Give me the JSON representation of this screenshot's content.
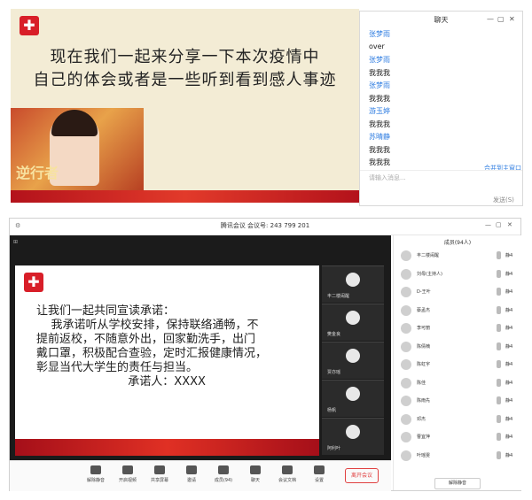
{
  "top_slide": {
    "line1": "现在我们一起来分享一下本次疫情中",
    "line2": "自己的体会或者是一些听到看到感人事迹",
    "poster_text": "逆行者"
  },
  "chat": {
    "title": "聊天",
    "messages": [
      {
        "text": "张梦雨",
        "kind": "name"
      },
      {
        "text": "over",
        "kind": "text"
      },
      {
        "text": "张梦雨",
        "kind": "name"
      },
      {
        "text": "我我我",
        "kind": "text"
      },
      {
        "text": "张梦雨",
        "kind": "name"
      },
      {
        "text": "我我我",
        "kind": "text"
      },
      {
        "text": "游玉婷",
        "kind": "name"
      },
      {
        "text": "我我我",
        "kind": "text"
      },
      {
        "text": "苏晴静",
        "kind": "name"
      },
      {
        "text": "我我我",
        "kind": "text"
      },
      {
        "text": "我我我",
        "kind": "text"
      }
    ],
    "merge_link": "合并到主窗口",
    "input_placeholder": "请输入消息...",
    "send_label": "发送(S)"
  },
  "meeting": {
    "window_title": "腾讯会议  会议号: 243 799 201",
    "slide_lines": [
      "让我们一起共同宣读承诺：",
      "    我承诺听从学校安排，保持联络通畅，不",
      "提前返校，不随意外出，回家勤洗手，出门",
      "戴口罩，积极配合查验，定时汇报健康情况，",
      "彰显当代大学生的责任与担当。",
      "                         承诺人：XXXX"
    ],
    "thumbnails": [
      "丰二楼闹醒",
      "樊金良",
      "贾亦瑶",
      "杨帆",
      "阿利叶"
    ],
    "toolbar": [
      "解除静音",
      "开启视频",
      "共享屏幕",
      "邀请",
      "成员(94)",
      "聊天",
      "会议文档",
      "设置"
    ],
    "leave_label": "离开会议"
  },
  "members": {
    "header": "成员(94人)",
    "list": [
      {
        "name": "丰二楼闹醒",
        "action": "静4"
      },
      {
        "name": "刘母(主持人)",
        "action": "静4"
      },
      {
        "name": "D-王叶",
        "action": "静4"
      },
      {
        "name": "蔡孟杰",
        "action": "静4"
      },
      {
        "name": "李可丽",
        "action": "静4"
      },
      {
        "name": "陈倩楠",
        "action": "静4"
      },
      {
        "name": "陈虹宇",
        "action": "静4"
      },
      {
        "name": "陈佳",
        "action": "静4"
      },
      {
        "name": "陈雨先",
        "action": "静4"
      },
      {
        "name": "邓杰",
        "action": "静4"
      },
      {
        "name": "曹宜萍",
        "action": "静4"
      },
      {
        "name": "叶瑶雯",
        "action": "静4"
      }
    ],
    "mute_all": "解除静音"
  }
}
